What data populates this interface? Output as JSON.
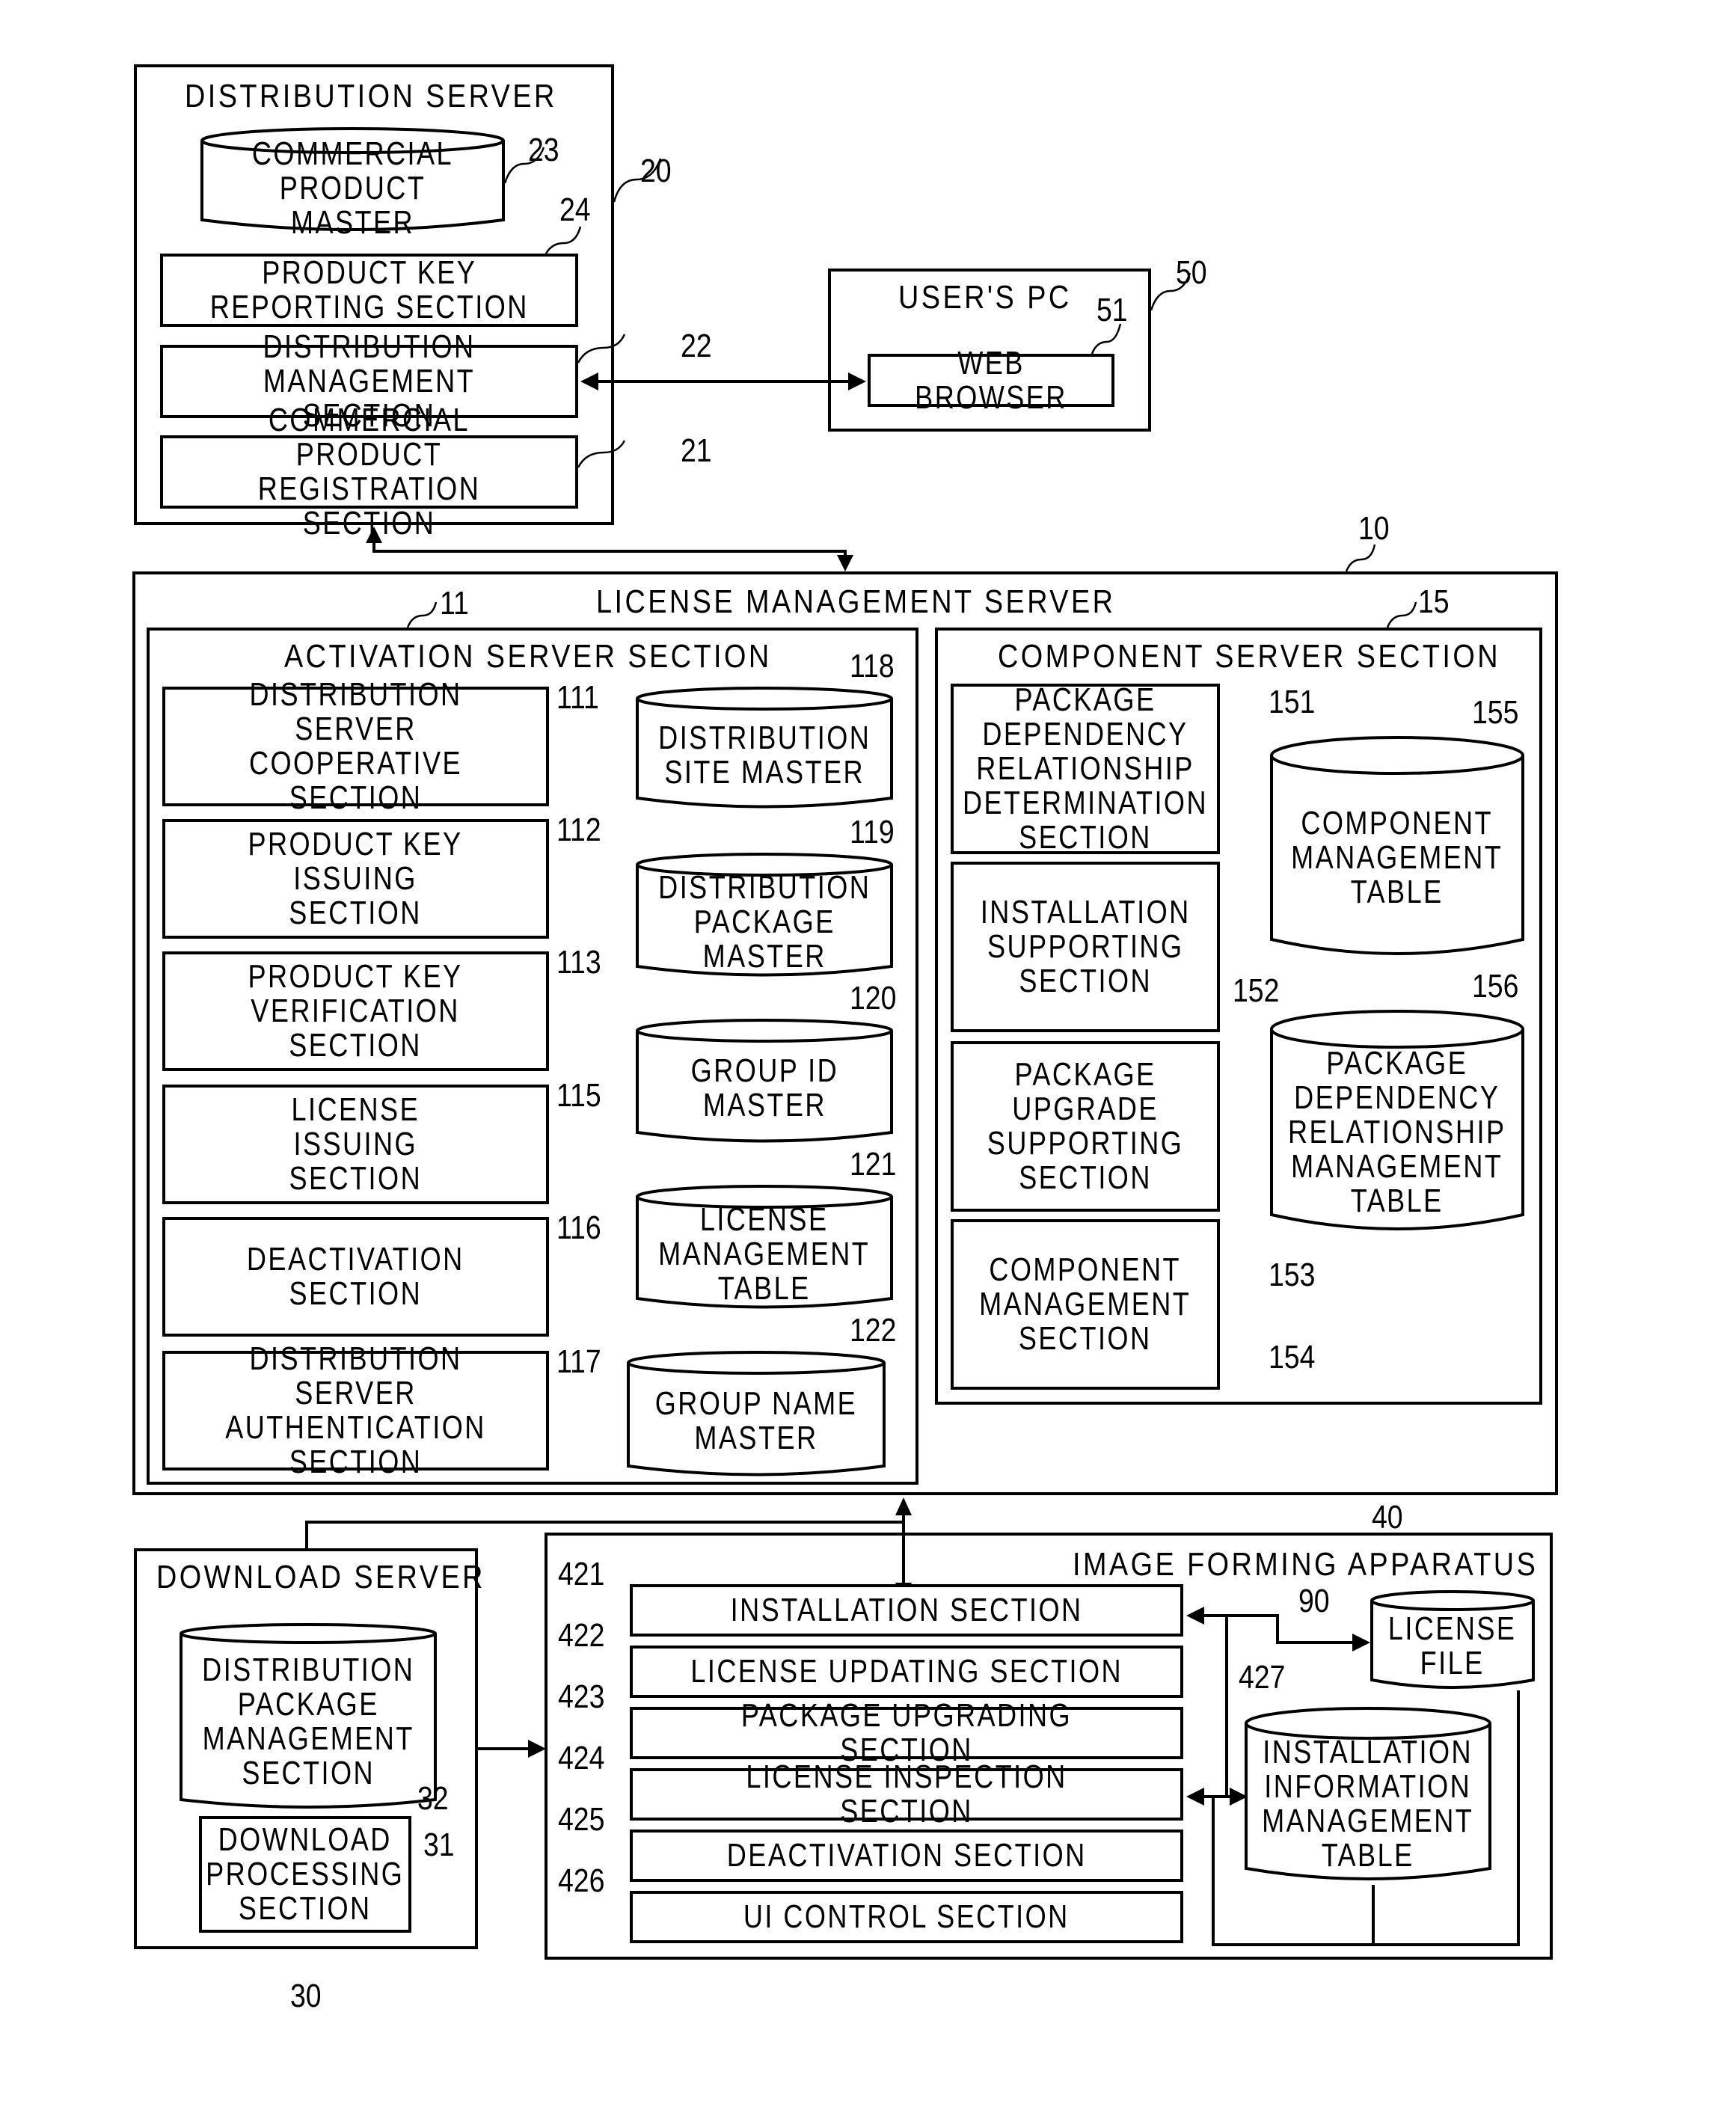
{
  "distribution_server": {
    "title": "DISTRIBUTION SERVER",
    "ref": "20",
    "commercial_product_master": {
      "label": "COMMERCIAL\nPRODUCT MASTER",
      "ref": "23"
    },
    "product_key_reporting": {
      "label": "PRODUCT KEY\nREPORTING SECTION",
      "ref": "24"
    },
    "distribution_management": {
      "label": "DISTRIBUTION\nMANAGEMENT SECTION",
      "ref": "22"
    },
    "commercial_product_registration": {
      "label": "COMMERCIAL PRODUCT\nREGISTRATION SECTION",
      "ref": "21"
    }
  },
  "users_pc": {
    "title": "USER'S PC",
    "ref": "50",
    "web_browser": {
      "label": "WEB BROWSER",
      "ref": "51"
    }
  },
  "license_management_server": {
    "title": "LICENSE MANAGEMENT SERVER",
    "ref": "10",
    "activation_server": {
      "title": "ACTIVATION SERVER SECTION",
      "ref": "11",
      "sections": [
        {
          "label": "DISTRIBUTION\nSERVER COOPERATIVE\nSECTION",
          "ref": "111"
        },
        {
          "label": "PRODUCT KEY\nISSUING\nSECTION",
          "ref": "112"
        },
        {
          "label": "PRODUCT KEY\nVERIFICATION\nSECTION",
          "ref": "113"
        },
        {
          "label": "LICENSE\nISSUING\nSECTION",
          "ref": "115"
        },
        {
          "label": "DEACTIVATION\nSECTION",
          "ref": "116"
        },
        {
          "label": "DISTRIBUTION SERVER\nAUTHENTICATION\nSECTION",
          "ref": "117"
        }
      ],
      "databases": [
        {
          "label": "DISTRIBUTION\nSITE MASTER",
          "ref": "118"
        },
        {
          "label": "DISTRIBUTION\nPACKAGE\nMASTER",
          "ref": "119"
        },
        {
          "label": "GROUP ID\nMASTER",
          "ref": "120"
        },
        {
          "label": "LICENSE\nMANAGEMENT\nTABLE",
          "ref": "121"
        },
        {
          "label": "GROUP NAME\nMASTER",
          "ref": "122"
        }
      ]
    },
    "component_server": {
      "title": "COMPONENT SERVER SECTION",
      "ref": "15",
      "sections": [
        {
          "label": "PACKAGE\nDEPENDENCY\nRELATIONSHIP\nDETERMINATION\nSECTION",
          "ref": "151"
        },
        {
          "label": "INSTALLATION\nSUPPORTING\nSECTION",
          "ref": "152"
        },
        {
          "label": "PACKAGE\nUPGRADE\nSUPPORTING\nSECTION",
          "ref": "153"
        },
        {
          "label": "COMPONENT\nMANAGEMENT\nSECTION",
          "ref": "154"
        }
      ],
      "databases": [
        {
          "label": "COMPONENT\nMANAGEMENT\nTABLE",
          "ref": "155"
        },
        {
          "label": "PACKAGE\nDEPENDENCY\nRELATIONSHIP\nMANAGEMENT\nTABLE",
          "ref": "156"
        }
      ]
    }
  },
  "download_server": {
    "title": "DOWNLOAD SERVER",
    "ref": "30",
    "distribution_package_management": {
      "label": "DISTRIBUTION\nPACKAGE\nMANAGEMENT\nSECTION",
      "ref": "32"
    },
    "download_processing": {
      "label": "DOWNLOAD\nPROCESSING\nSECTION",
      "ref": "31"
    }
  },
  "image_forming_apparatus": {
    "title": "IMAGE FORMING APPARATUS",
    "ref": "40",
    "sections": [
      {
        "label": "INSTALLATION SECTION",
        "ref": "421"
      },
      {
        "label": "LICENSE UPDATING SECTION",
        "ref": "422"
      },
      {
        "label": "PACKAGE UPGRADING SECTION",
        "ref": "423"
      },
      {
        "label": "LICENSE INSPECTION SECTION",
        "ref": "424"
      },
      {
        "label": "DEACTIVATION SECTION",
        "ref": "425"
      },
      {
        "label": "UI CONTROL SECTION",
        "ref": "426"
      }
    ],
    "license_file": {
      "label": "LICENSE\nFILE",
      "ref": "90"
    },
    "installation_info_table": {
      "label": "INSTALLATION\nINFORMATION\nMANAGEMENT\nTABLE",
      "ref": "427"
    }
  }
}
